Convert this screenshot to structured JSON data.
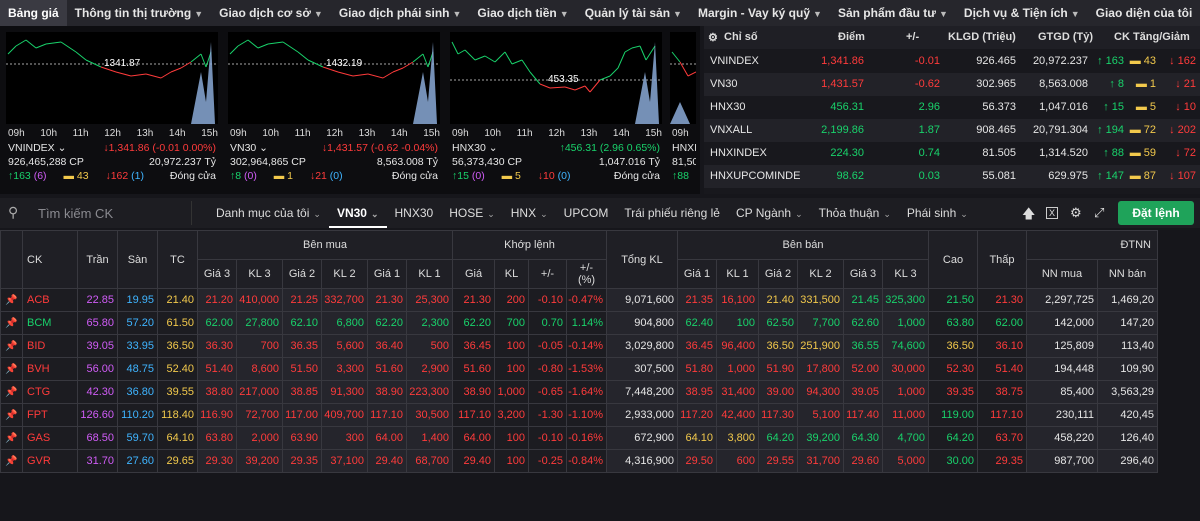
{
  "nav": [
    {
      "label": "Bảng giá",
      "active": true,
      "chevron": false
    },
    {
      "label": "Thông tin thị trường",
      "chevron": true
    },
    {
      "label": "Giao dịch cơ sở",
      "chevron": true
    },
    {
      "label": "Giao dịch phái sinh",
      "chevron": true
    },
    {
      "label": "Giao dịch tiền",
      "chevron": true
    },
    {
      "label": "Quản lý tài sản",
      "chevron": true
    },
    {
      "label": "Margin - Vay ký quỹ",
      "chevron": true
    },
    {
      "label": "Sản phẩm đầu tư",
      "chevron": true
    },
    {
      "label": "Dịch vụ & Tiện ích",
      "chevron": true
    },
    {
      "label": "Giao diện của tôi",
      "chevron": false
    }
  ],
  "charts": [
    {
      "name": "VNINDEX",
      "price_label": "1341.87",
      "change": "↓1,341.86 (-0.01 0.00%)",
      "volume": "926,465,288 CP",
      "value": "20,972.237 Tỷ",
      "up": "↑163",
      "ce": "(6)",
      "ref": "43",
      "dn": "↓162",
      "fl": "(1)",
      "status": "Đóng cửa",
      "ticks": [
        "09h",
        "10h",
        "11h",
        "12h",
        "13h",
        "14h",
        "15h"
      ],
      "trend": "down"
    },
    {
      "name": "VN30",
      "price_label": "1432.19",
      "change": "↓1,431.57 (-0.62 -0.04%)",
      "volume": "302,964,865 CP",
      "value": "8,563.008 Tỷ",
      "up": "↑8",
      "ce": "(0)",
      "ref": "1",
      "dn": "↓21",
      "fl": "(0)",
      "status": "Đóng cửa",
      "ticks": [
        "09h",
        "10h",
        "11h",
        "12h",
        "13h",
        "14h",
        "15h"
      ],
      "trend": "down"
    },
    {
      "name": "HNX30",
      "price_label": "453.35",
      "change": "↑456.31 (2.96 0.65%)",
      "volume": "56,373,430 CP",
      "value": "1,047.016 Tỷ",
      "up": "↑15",
      "ce": "(0)",
      "ref": "5",
      "dn": "↓10",
      "fl": "(0)",
      "status": "Đóng cửa",
      "ticks": [
        "09h",
        "10h",
        "11h",
        "12h",
        "13h",
        "14h",
        "15h"
      ],
      "trend": "up"
    },
    {
      "name": "HNXINDEX",
      "volume": "81,50",
      "up": "↑88",
      "ticks": [
        "09h"
      ]
    }
  ],
  "index_table": {
    "headers": {
      "name": "Chỉ số",
      "point": "Điểm",
      "change": "+/-",
      "vol": "KLGD (Triệu)",
      "val": "GTGD (Tỷ)",
      "ck": "CK Tăng/Giảm"
    },
    "rows": [
      {
        "name": "VNINDEX",
        "point": "1,341.86",
        "change": "-0.01",
        "vol": "926.465",
        "val": "20,972.237",
        "up": "↑ 163",
        "ref": "43",
        "dn": "↓ 162",
        "dir": "dn"
      },
      {
        "name": "VN30",
        "point": "1,431.57",
        "change": "-0.62",
        "vol": "302.965",
        "val": "8,563.008",
        "up": "↑ 8",
        "ref": "1",
        "dn": "↓ 21",
        "dir": "dn"
      },
      {
        "name": "HNX30",
        "point": "456.31",
        "change": "2.96",
        "vol": "56.373",
        "val": "1,047.016",
        "up": "↑ 15",
        "ref": "5",
        "dn": "↓ 10",
        "dir": "up"
      },
      {
        "name": "VNXALL",
        "point": "2,199.86",
        "change": "1.87",
        "vol": "908.465",
        "val": "20,791.304",
        "up": "↑ 194",
        "ref": "72",
        "dn": "↓ 202",
        "dir": "up"
      },
      {
        "name": "HNXINDEX",
        "point": "224.30",
        "change": "0.74",
        "vol": "81.505",
        "val": "1,314.520",
        "up": "↑ 88",
        "ref": "59",
        "dn": "↓ 72",
        "dir": "up"
      },
      {
        "name": "HNXUPCOMINDE",
        "point": "98.62",
        "change": "0.03",
        "vol": "55.081",
        "val": "629.975",
        "up": "↑ 147",
        "ref": "87",
        "dn": "↓ 107",
        "dir": "up"
      }
    ]
  },
  "toolbar": {
    "search_placeholder": "Tìm kiếm CK",
    "tabs": [
      {
        "label": "Danh mục của tôi",
        "chevron": true
      },
      {
        "label": "VN30",
        "chevron": true,
        "active": true
      },
      {
        "label": "HNX30"
      },
      {
        "label": "HOSE",
        "chevron": true
      },
      {
        "label": "HNX",
        "chevron": true
      },
      {
        "label": "UPCOM"
      },
      {
        "label": "Trái phiếu riêng lẻ"
      },
      {
        "label": "CP Ngành",
        "chevron": true
      },
      {
        "label": "Thỏa thuận",
        "chevron": true
      },
      {
        "label": "Phái sinh",
        "chevron": true
      }
    ],
    "order_label": "Đặt lệnh"
  },
  "board": {
    "h": {
      "ck": "CK",
      "tran": "Trần",
      "san": "Sàn",
      "tc": "TC",
      "buy": "Bên mua",
      "match": "Khớp lệnh",
      "total": "Tổng KL",
      "sell": "Bên bán",
      "high": "Cao",
      "low": "Thấp",
      "dtnn": "ĐTNN",
      "p3": "Giá 3",
      "k3": "KL 3",
      "p2": "Giá 2",
      "k2": "KL 2",
      "p1": "Giá 1",
      "k1": "KL 1",
      "mp": "Giá",
      "mk": "KL",
      "pm": "+/-",
      "pct": "+/-\n(%)",
      "sp1": "Giá 1",
      "sk1": "KL 1",
      "sp2": "Giá 2",
      "sk2": "KL 2",
      "sp3": "Giá 3",
      "sk3": "KL 3",
      "nnb": "NN mua",
      "nns": "NN bán"
    },
    "rows": [
      {
        "ck": "ACB",
        "c": "dn",
        "tran": "22.85",
        "san": "19.95",
        "tc": "21.40",
        "b": [
          [
            "21.20",
            "dn"
          ],
          [
            "410,000",
            "dn"
          ],
          [
            "21.25",
            "dn"
          ],
          [
            "332,700",
            "dn"
          ],
          [
            "21.30",
            "dn"
          ],
          [
            "25,300",
            "dn"
          ]
        ],
        "m": [
          [
            "21.30",
            "dn"
          ],
          [
            "200",
            "dn"
          ],
          [
            "-0.10",
            "dn"
          ],
          [
            "-0.47%",
            "dn"
          ]
        ],
        "tot": "9,071,600",
        "s": [
          [
            "21.35",
            "dn"
          ],
          [
            "16,100",
            "dn"
          ],
          [
            "21.40",
            "ref"
          ],
          [
            "331,500",
            "ref"
          ],
          [
            "21.45",
            "up"
          ],
          [
            "325,300",
            "up"
          ]
        ],
        "hi": [
          "21.50",
          "up"
        ],
        "lo": [
          "21.30",
          "dn"
        ],
        "nnb": "2,297,725",
        "nns": "1,469,20"
      },
      {
        "ck": "BCM",
        "c": "up",
        "tran": "65.80",
        "san": "57.20",
        "tc": "61.50",
        "b": [
          [
            "62.00",
            "up"
          ],
          [
            "27,800",
            "up"
          ],
          [
            "62.10",
            "up"
          ],
          [
            "6,800",
            "up"
          ],
          [
            "62.20",
            "up"
          ],
          [
            "2,300",
            "up"
          ]
        ],
        "m": [
          [
            "62.20",
            "up"
          ],
          [
            "700",
            "up"
          ],
          [
            "0.70",
            "up"
          ],
          [
            "1.14%",
            "up"
          ]
        ],
        "tot": "904,800",
        "s": [
          [
            "62.40",
            "up"
          ],
          [
            "100",
            "up"
          ],
          [
            "62.50",
            "up"
          ],
          [
            "7,700",
            "up"
          ],
          [
            "62.60",
            "up"
          ],
          [
            "1,000",
            "up"
          ]
        ],
        "hi": [
          "63.80",
          "up"
        ],
        "lo": [
          "62.00",
          "up"
        ],
        "nnb": "142,000",
        "nns": "147,20"
      },
      {
        "ck": "BID",
        "c": "dn",
        "tran": "39.05",
        "san": "33.95",
        "tc": "36.50",
        "b": [
          [
            "36.30",
            "dn"
          ],
          [
            "700",
            "dn"
          ],
          [
            "36.35",
            "dn"
          ],
          [
            "5,600",
            "dn"
          ],
          [
            "36.40",
            "dn"
          ],
          [
            "500",
            "dn"
          ]
        ],
        "m": [
          [
            "36.45",
            "dn"
          ],
          [
            "100",
            "dn"
          ],
          [
            "-0.05",
            "dn"
          ],
          [
            "-0.14%",
            "dn"
          ]
        ],
        "tot": "3,029,800",
        "s": [
          [
            "36.45",
            "dn"
          ],
          [
            "96,400",
            "dn"
          ],
          [
            "36.50",
            "ref"
          ],
          [
            "251,900",
            "ref"
          ],
          [
            "36.55",
            "up"
          ],
          [
            "74,600",
            "up"
          ]
        ],
        "hi": [
          "36.50",
          "ref"
        ],
        "lo": [
          "36.10",
          "dn"
        ],
        "nnb": "125,809",
        "nns": "113,40"
      },
      {
        "ck": "BVH",
        "c": "dn",
        "tran": "56.00",
        "san": "48.75",
        "tc": "52.40",
        "b": [
          [
            "51.40",
            "dn"
          ],
          [
            "8,600",
            "dn"
          ],
          [
            "51.50",
            "dn"
          ],
          [
            "3,300",
            "dn"
          ],
          [
            "51.60",
            "dn"
          ],
          [
            "2,900",
            "dn"
          ]
        ],
        "m": [
          [
            "51.60",
            "dn"
          ],
          [
            "100",
            "dn"
          ],
          [
            "-0.80",
            "dn"
          ],
          [
            "-1.53%",
            "dn"
          ]
        ],
        "tot": "307,500",
        "s": [
          [
            "51.80",
            "dn"
          ],
          [
            "1,000",
            "dn"
          ],
          [
            "51.90",
            "dn"
          ],
          [
            "17,800",
            "dn"
          ],
          [
            "52.00",
            "dn"
          ],
          [
            "30,000",
            "dn"
          ]
        ],
        "hi": [
          "52.30",
          "dn"
        ],
        "lo": [
          "51.40",
          "dn"
        ],
        "nnb": "194,448",
        "nns": "109,90"
      },
      {
        "ck": "CTG",
        "c": "dn",
        "tran": "42.30",
        "san": "36.80",
        "tc": "39.55",
        "b": [
          [
            "38.80",
            "dn"
          ],
          [
            "217,000",
            "dn"
          ],
          [
            "38.85",
            "dn"
          ],
          [
            "91,300",
            "dn"
          ],
          [
            "38.90",
            "dn"
          ],
          [
            "223,300",
            "dn"
          ]
        ],
        "m": [
          [
            "38.90",
            "dn"
          ],
          [
            "1,000",
            "dn"
          ],
          [
            "-0.65",
            "dn"
          ],
          [
            "-1.64%",
            "dn"
          ]
        ],
        "tot": "7,448,200",
        "s": [
          [
            "38.95",
            "dn"
          ],
          [
            "31,400",
            "dn"
          ],
          [
            "39.00",
            "dn"
          ],
          [
            "94,300",
            "dn"
          ],
          [
            "39.05",
            "dn"
          ],
          [
            "1,000",
            "dn"
          ]
        ],
        "hi": [
          "39.35",
          "dn"
        ],
        "lo": [
          "38.75",
          "dn"
        ],
        "nnb": "85,400",
        "nns": "3,563,29"
      },
      {
        "ck": "FPT",
        "c": "dn",
        "tran": "126.60",
        "san": "110.20",
        "tc": "118.40",
        "b": [
          [
            "116.90",
            "dn"
          ],
          [
            "72,700",
            "dn"
          ],
          [
            "117.00",
            "dn"
          ],
          [
            "409,700",
            "dn"
          ],
          [
            "117.10",
            "dn"
          ],
          [
            "30,500",
            "dn"
          ]
        ],
        "m": [
          [
            "117.10",
            "dn"
          ],
          [
            "3,200",
            "dn"
          ],
          [
            "-1.30",
            "dn"
          ],
          [
            "-1.10%",
            "dn"
          ]
        ],
        "tot": "2,933,000",
        "s": [
          [
            "117.20",
            "dn"
          ],
          [
            "42,400",
            "dn"
          ],
          [
            "117.30",
            "dn"
          ],
          [
            "5,100",
            "dn"
          ],
          [
            "117.40",
            "dn"
          ],
          [
            "11,000",
            "dn"
          ]
        ],
        "hi": [
          "119.00",
          "up"
        ],
        "lo": [
          "117.10",
          "dn"
        ],
        "nnb": "230,111",
        "nns": "420,45"
      },
      {
        "ck": "GAS",
        "c": "dn",
        "tran": "68.50",
        "san": "59.70",
        "tc": "64.10",
        "b": [
          [
            "63.80",
            "dn"
          ],
          [
            "2,000",
            "dn"
          ],
          [
            "63.90",
            "dn"
          ],
          [
            "300",
            "dn"
          ],
          [
            "64.00",
            "dn"
          ],
          [
            "1,400",
            "dn"
          ]
        ],
        "m": [
          [
            "64.00",
            "dn"
          ],
          [
            "100",
            "dn"
          ],
          [
            "-0.10",
            "dn"
          ],
          [
            "-0.16%",
            "dn"
          ]
        ],
        "tot": "672,900",
        "s": [
          [
            "64.10",
            "ref"
          ],
          [
            "3,800",
            "ref"
          ],
          [
            "64.20",
            "up"
          ],
          [
            "39,200",
            "up"
          ],
          [
            "64.30",
            "up"
          ],
          [
            "4,700",
            "up"
          ]
        ],
        "hi": [
          "64.20",
          "up"
        ],
        "lo": [
          "63.70",
          "dn"
        ],
        "nnb": "458,220",
        "nns": "126,40"
      },
      {
        "ck": "GVR",
        "c": "dn",
        "tran": "31.70",
        "san": "27.60",
        "tc": "29.65",
        "b": [
          [
            "29.30",
            "dn"
          ],
          [
            "39,200",
            "dn"
          ],
          [
            "29.35",
            "dn"
          ],
          [
            "37,100",
            "dn"
          ],
          [
            "29.40",
            "dn"
          ],
          [
            "68,700",
            "dn"
          ]
        ],
        "m": [
          [
            "29.40",
            "dn"
          ],
          [
            "100",
            "dn"
          ],
          [
            "-0.25",
            "dn"
          ],
          [
            "-0.84%",
            "dn"
          ]
        ],
        "tot": "4,316,900",
        "s": [
          [
            "29.50",
            "dn"
          ],
          [
            "600",
            "dn"
          ],
          [
            "29.55",
            "dn"
          ],
          [
            "31,700",
            "dn"
          ],
          [
            "29.60",
            "dn"
          ],
          [
            "5,000",
            "dn"
          ]
        ],
        "hi": [
          "30.00",
          "up"
        ],
        "lo": [
          "29.35",
          "dn"
        ],
        "nnb": "987,700",
        "nns": "296,40"
      }
    ]
  }
}
